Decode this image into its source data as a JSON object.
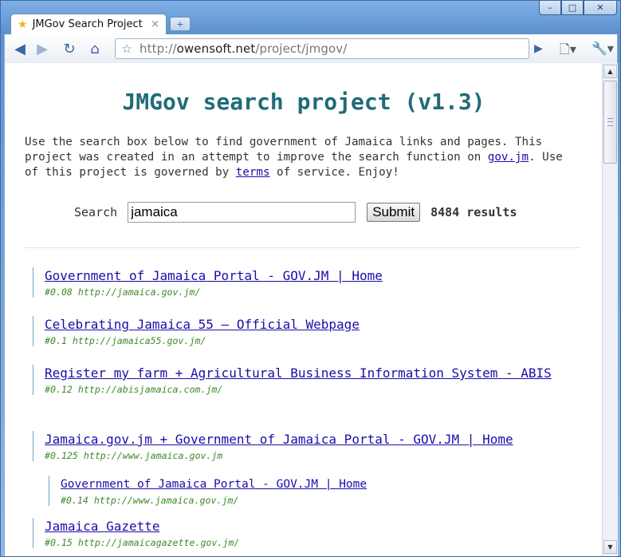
{
  "browser": {
    "tab_title": "JMGov Search Project",
    "tab_close": "×",
    "new_tab": "+",
    "url_scheme": "http://",
    "url_host": "owensoft.net",
    "url_path": "/project/jmgov/",
    "window_controls": [
      "–",
      "□",
      "✕"
    ]
  },
  "page": {
    "heading": "JMGov search project (v1.3)",
    "intro_before_gov": "Use the search box below to find government of Jamaica links and pages. This project was created in an attempt to improve the search function on ",
    "gov_link": "gov.jm",
    "intro_middle": ". Use of this project is governed by ",
    "terms_link": "terms",
    "intro_after": " of service. Enjoy!",
    "search_label": "Search",
    "search_value": "jamaica",
    "submit_label": "Submit",
    "results_count": "8484 results"
  },
  "results": [
    {
      "title": "Government of Jamaica Portal - GOV.JM | Home",
      "meta": "#0.08 http://jamaica.gov.jm/"
    },
    {
      "title": "Celebrating Jamaica 55 – Official Webpage",
      "meta": "#0.1 http://jamaica55.gov.jm/"
    },
    {
      "title": "Register my farm + Agricultural Business Information System - ABIS",
      "meta": "#0.12 http://abisjamaica.com.jm/"
    },
    {
      "title": "Jamaica.gov.jm + Government of Jamaica Portal - GOV.JM | Home",
      "meta": "#0.125 http://www.jamaica.gov.jm"
    },
    {
      "title": "Government of Jamaica Portal - GOV.JM | Home",
      "meta": "#0.14 http://www.jamaica.gov.jm/"
    },
    {
      "title": "Jamaica Gazette",
      "meta": "#0.15 http://jamaicagazette.gov.jm/"
    }
  ]
}
